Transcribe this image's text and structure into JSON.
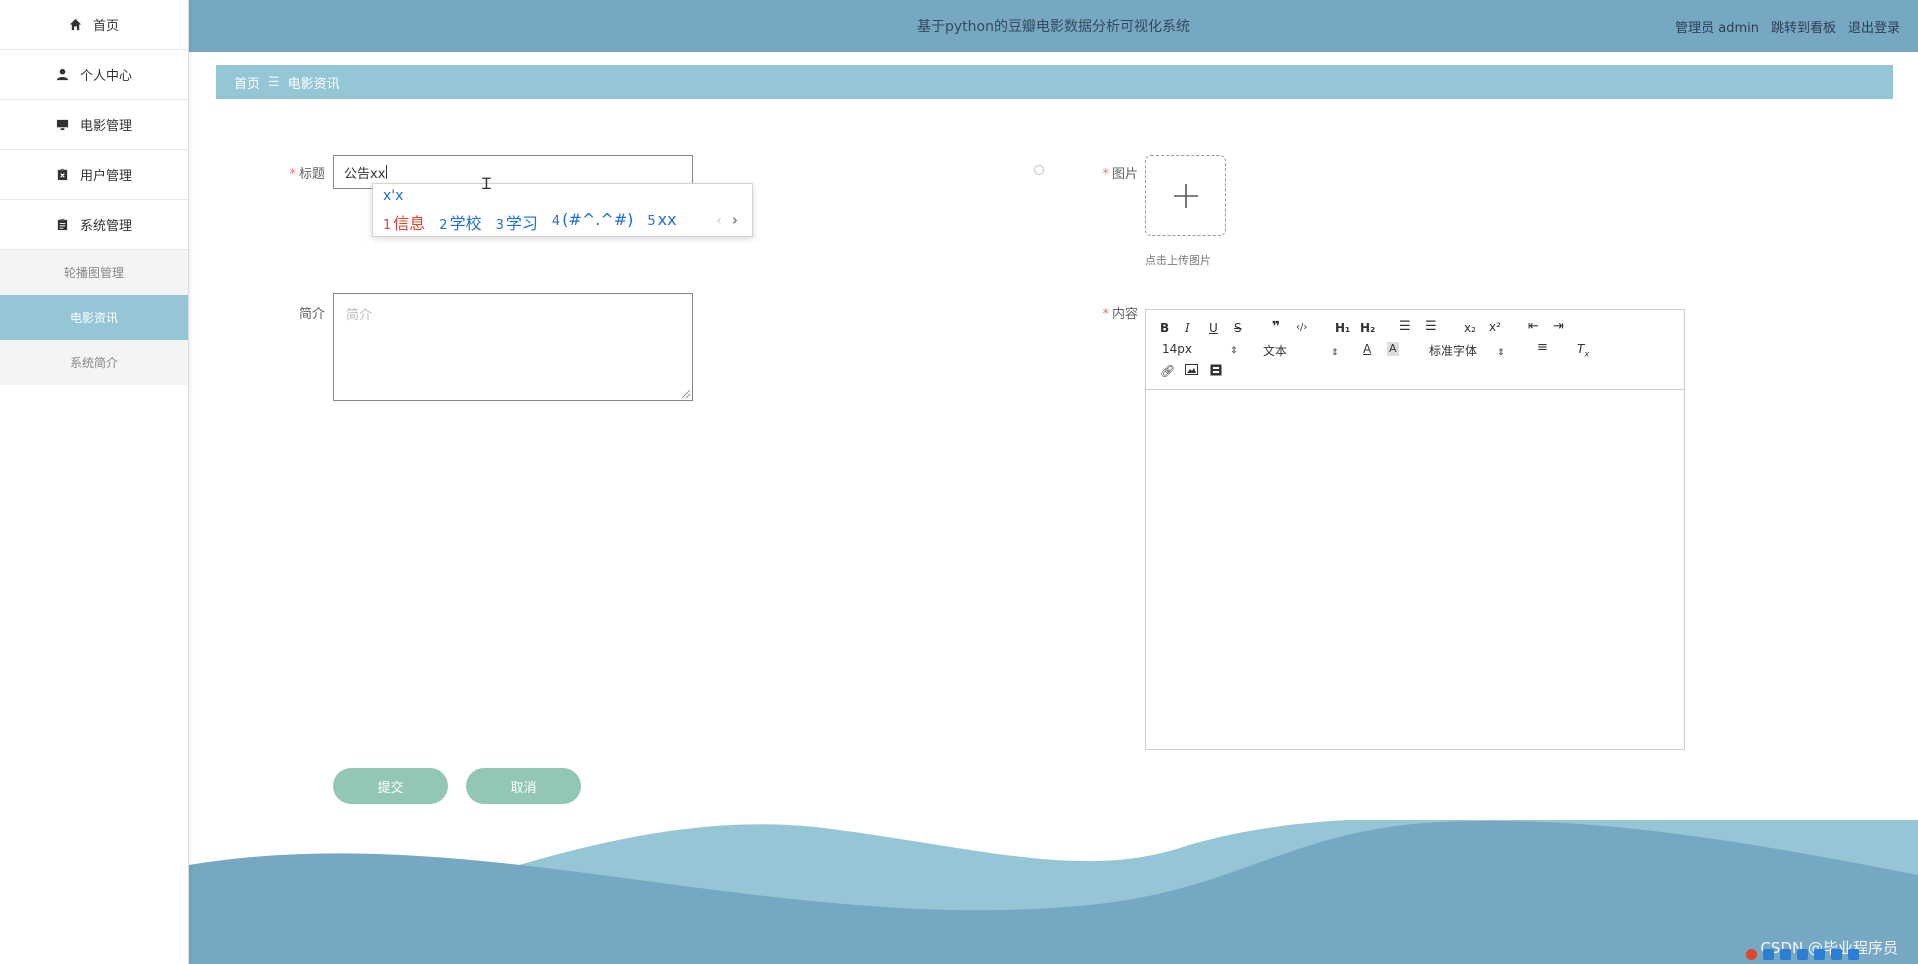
{
  "header": {
    "title": "基于python的豆瓣电影数据分析可视化系统",
    "user": "管理员 admin",
    "dashboard_link": "跳转到看板",
    "logout_link": "退出登录"
  },
  "sidebar": {
    "items": [
      {
        "label": "首页",
        "icon": "home-icon"
      },
      {
        "label": "个人中心",
        "icon": "user-icon"
      },
      {
        "label": "电影管理",
        "icon": "monitor-icon"
      },
      {
        "label": "用户管理",
        "icon": "clipboard-icon"
      },
      {
        "label": "系统管理",
        "icon": "clipboard-icon"
      }
    ],
    "sub_items": [
      {
        "label": "轮播图管理",
        "active": false
      },
      {
        "label": "电影资讯",
        "active": true
      },
      {
        "label": "系统简介",
        "active": false
      }
    ]
  },
  "breadcrumb": {
    "home": "首页",
    "separator": "☰",
    "current": "电影资讯"
  },
  "form": {
    "title_label": "标题",
    "title_value": "公告xx",
    "image_label": "图片",
    "upload_hint": "点击上传图片",
    "intro_label": "简介",
    "intro_placeholder": "简介",
    "content_label": "内容",
    "submit": "提交",
    "cancel": "取消"
  },
  "ime": {
    "composition": "x'x",
    "candidates": [
      {
        "n": "1",
        "text": "信息"
      },
      {
        "n": "2",
        "text": "学校"
      },
      {
        "n": "3",
        "text": "学习"
      },
      {
        "n": "4",
        "text": "(#^.^#)"
      },
      {
        "n": "5",
        "text": "xx"
      }
    ]
  },
  "editor": {
    "font_size": "14px",
    "block_type": "文本",
    "font_family": "标准字体"
  },
  "watermark": "CSDN @毕业程序员",
  "colors": {
    "header": "#76a8c3",
    "breadcrumb": "#95c6d6",
    "button": "#92c7b3",
    "required": "#f56c6c"
  }
}
